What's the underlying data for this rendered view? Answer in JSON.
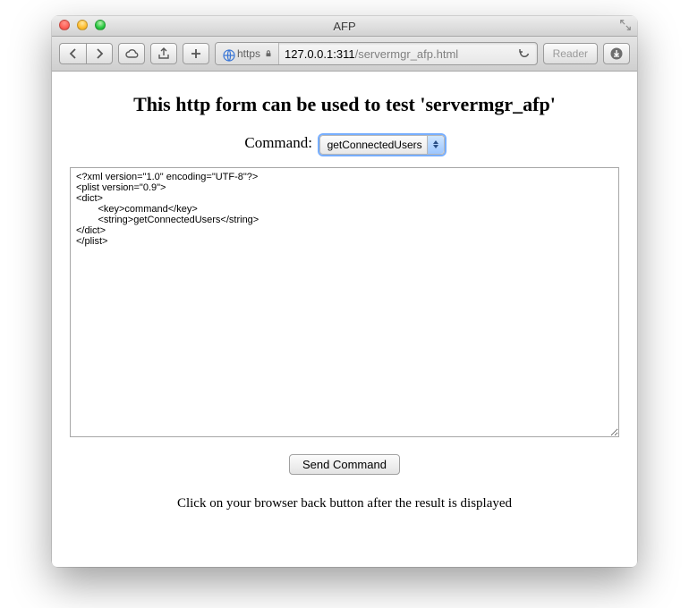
{
  "window": {
    "title": "AFP"
  },
  "toolbar": {
    "scheme": "https",
    "host": "127.0.0.1:311",
    "path": "/servermgr_afp.html",
    "reader": "Reader"
  },
  "page": {
    "heading": "This http form can be used to test 'servermgr_afp'",
    "command_label": "Command:",
    "command_selected": "getConnectedUsers",
    "textarea": "<?xml version=\"1.0\" encoding=\"UTF-8\"?>\n<plist version=\"0.9\">\n<dict>\n\t<key>command</key>\n\t<string>getConnectedUsers</string>\n</dict>\n</plist>",
    "send_button": "Send Command",
    "hint": "Click on your browser back button after the result is displayed"
  }
}
